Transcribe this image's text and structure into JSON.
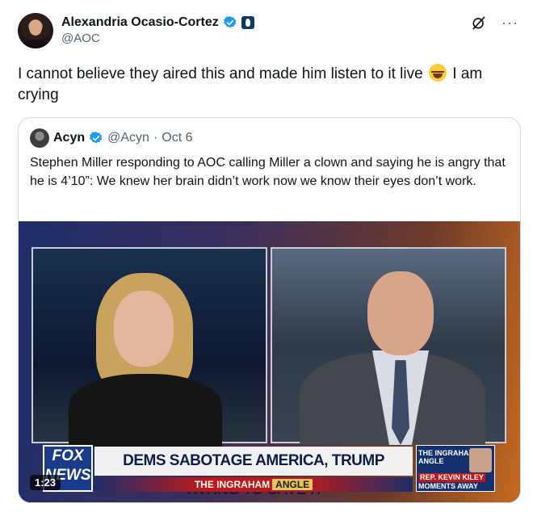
{
  "author": {
    "name": "Alexandria Ocasio-Cortez",
    "handle": "@AOC",
    "verified_icon": "verified-badge-icon",
    "affiliation_icon": "government-affiliation-icon"
  },
  "actions": {
    "grok_icon": "grok-icon",
    "more_label": "···"
  },
  "tweet": {
    "text_before": "I cannot believe they aired this and made him listen to it live",
    "emoji": "face-with-tears-of-joy",
    "text_after": "I am crying"
  },
  "quote": {
    "name": "Acyn",
    "handle": "@Acyn",
    "separator": "·",
    "date": "Oct 6",
    "text": "Stephen Miller responding to AOC calling Miller a clown and saying he is angry that he is 4’10”: We knew her brain didn’t work now we know their eyes don’t work."
  },
  "video": {
    "duration": "1:23",
    "logo_line1": "FOX",
    "logo_line2": "NEWS",
    "chyron": "DEMS SABOTAGE AMERICA, TRUMP TRYING TO SAVE IT",
    "show_name_prefix": "THE INGRAHAM",
    "show_name_suffix": "ANGLE",
    "side_top": "THE INGRAHAM ANGLE",
    "side_mid": "REP. KEVIN KILEY",
    "side_bot": "MOMENTS AWAY"
  },
  "colors": {
    "verified_blue": "#1d9bf0",
    "secondary_text": "#536471",
    "border": "#cfd9de"
  }
}
